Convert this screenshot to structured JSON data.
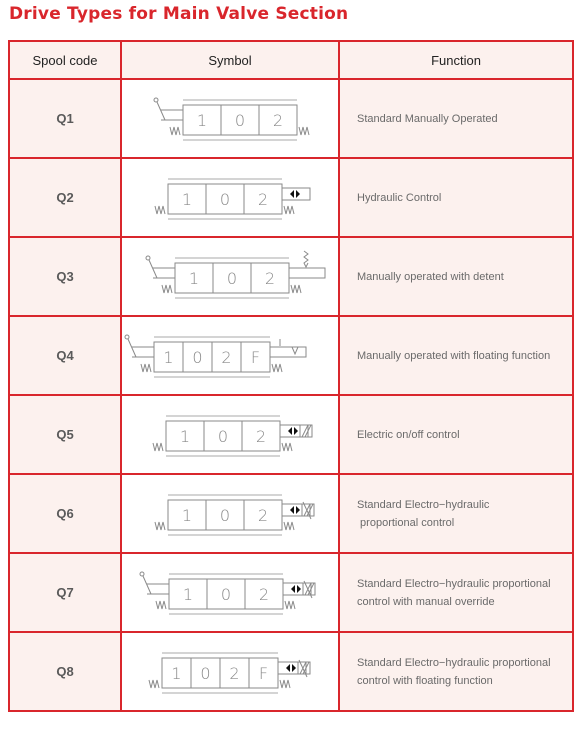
{
  "title": "Drive Types for Main Valve Section",
  "colors": {
    "accent": "#d9262c",
    "header_bg": "#fcf1ee",
    "symbol_line": "#8a8a8a"
  },
  "headers": {
    "code": "Spool code",
    "symbol": "Symbol",
    "function": "Function"
  },
  "rows": [
    {
      "code": "Q1",
      "function": "Standard Manually Operated",
      "symbol": {
        "positions": [
          "1",
          "0",
          "2"
        ],
        "left": "lever-spring",
        "right": "spring"
      }
    },
    {
      "code": "Q2",
      "function": "Hydraulic Control",
      "symbol": {
        "positions": [
          "1",
          "0",
          "2"
        ],
        "left": "spring",
        "right": "spring-hydraulic"
      }
    },
    {
      "code": "Q3",
      "function": "Manually operated with detent",
      "symbol": {
        "positions": [
          "1",
          "0",
          "2"
        ],
        "left": "lever-spring",
        "right": "spring-detent"
      }
    },
    {
      "code": "Q4",
      "function": "Manually operated with floating function",
      "symbol": {
        "positions": [
          "1",
          "0",
          "2",
          "F"
        ],
        "left": "lever-spring",
        "right": "spring-float-detent"
      }
    },
    {
      "code": "Q5",
      "function": "Electric on/off control",
      "symbol": {
        "positions": [
          "1",
          "0",
          "2"
        ],
        "left": "spring",
        "right": "spring-solenoid"
      }
    },
    {
      "code": "Q6",
      "function": "Standard Electro-hydraulic\n proportional control",
      "function_lines": [
        "Standard Electro−hydraulic",
        " proportional control"
      ],
      "symbol": {
        "positions": [
          "1",
          "0",
          "2"
        ],
        "left": "spring",
        "right": "spring-proportional-solenoid"
      }
    },
    {
      "code": "Q7",
      "function": "Standard Electro-hydraulic proportional control with manual override",
      "function_lines": [
        "Standard Electro−hydraulic proportional",
        "control with manual override"
      ],
      "symbol": {
        "positions": [
          "1",
          "0",
          "2"
        ],
        "left": "lever-spring",
        "right": "spring-proportional-solenoid"
      }
    },
    {
      "code": "Q8",
      "function": "Standard Electro-hydraulic proportional control with floating function",
      "function_lines": [
        "Standard Electro−hydraulic proportional",
        "control with floating function"
      ],
      "symbol": {
        "positions": [
          "1",
          "0",
          "2",
          "F"
        ],
        "left": "spring",
        "right": "spring-proportional-solenoid"
      }
    }
  ]
}
